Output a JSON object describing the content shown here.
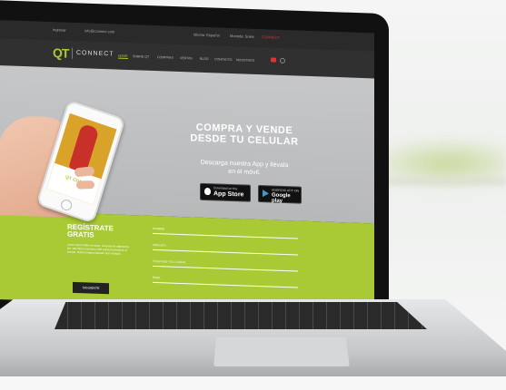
{
  "topbar": {
    "email": "Ingresar",
    "phone": "info@connect.com",
    "lang": "Idioma: Español",
    "currency": "Moneda: Soles",
    "brand_colors": "CONNECT"
  },
  "nav": {
    "logo_mark": "QT",
    "logo_text": "CONNECT",
    "items": [
      "HOME",
      "SOBRE QT",
      "COMPRAS",
      "VENTAS",
      "BLOG",
      "CONTACTO",
      "NOSOTROS"
    ]
  },
  "hero": {
    "title_line1": "COMPRA Y VENDE",
    "title_line2": "DESDE TU CELULAR",
    "subtitle_line1": "Descarga nuestra App y llévala",
    "subtitle_line2": "en el móvil.",
    "appstore_small": "Download on the",
    "appstore_big": "App Store",
    "googleplay_small": "ANDROID APP ON",
    "googleplay_big": "Google play"
  },
  "phone": {
    "logo": "QT CONNECT"
  },
  "register": {
    "title_line1": "REGÍSTRATE",
    "title_line2": "GRATIS",
    "text": "Lorem ipsum dolor sit amet, consectetur adipiscing elit, sed diam nonummy nibh euismod tincidunt ut laoreet. Dolore magna aliquam erat volutpat.",
    "next_button": "SIGUIENTE",
    "fields": [
      "NOMBRE",
      "APELLIDO",
      "TELÉFONO FIJO O MÓVIL",
      "EMAIL"
    ]
  },
  "colors": {
    "accent": "#a9c935",
    "dark": "#303030",
    "hero_bg": "#c0c1c3"
  }
}
